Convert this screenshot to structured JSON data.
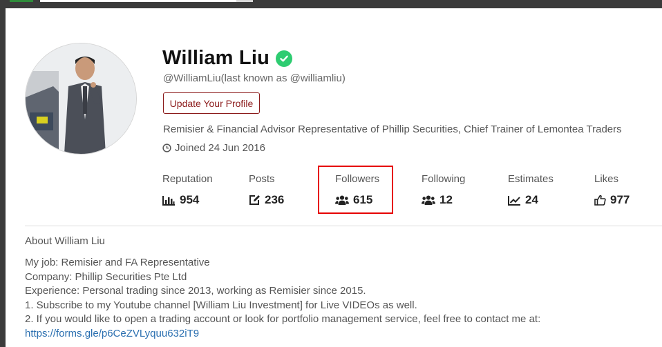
{
  "profile": {
    "name": "William Liu",
    "handle": "@WilliamLiu(last known as @williamliu)",
    "update_button": "Update Your Profile",
    "bio": "Remisier & Financial Advisor Representative of Phillip Securities, Chief Trainer of Lemontea Traders",
    "joined": "Joined 24 Jun 2016"
  },
  "stats": [
    {
      "label": "Reputation",
      "value": "954",
      "icon": "bar-chart-icon"
    },
    {
      "label": "Posts",
      "value": "236",
      "icon": "edit-icon"
    },
    {
      "label": "Followers",
      "value": "615",
      "icon": "users-icon"
    },
    {
      "label": "Following",
      "value": "12",
      "icon": "users-icon"
    },
    {
      "label": "Estimates",
      "value": "24",
      "icon": "line-chart-icon"
    },
    {
      "label": "Likes",
      "value": "977",
      "icon": "thumbs-up-icon"
    }
  ],
  "about": {
    "title": "About William Liu",
    "lines": [
      "My job: Remisier and FA Representative",
      "Company: Phillip Securities Pte Ltd",
      "Experience: Personal trading since 2013, working as Remisier since 2015.",
      "1. Subscribe to my Youtube channel [William Liu Investment] for Live VIDEOs as well.",
      "2. If you would like to open a trading account or look for portfolio management service, feel free to contact me at:"
    ],
    "link": "https://forms.gle/p6CeZVLyquu632iT9"
  },
  "colors": {
    "accent_dark_red": "#8b1a1a",
    "verified_green": "#2ecc71",
    "highlight_red": "#e60000",
    "link_blue": "#2a6fb0"
  }
}
